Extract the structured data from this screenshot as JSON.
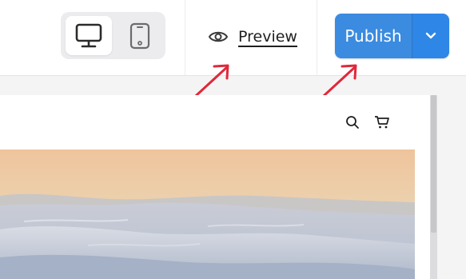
{
  "toolbar": {
    "device_toggle": {
      "desktop_icon": "monitor-icon",
      "mobile_icon": "smartphone-icon",
      "selected": "desktop"
    },
    "preview": {
      "icon": "eye-icon",
      "label": "Preview"
    },
    "publish": {
      "label": "Publish",
      "dropdown_icon": "chevron-down-icon"
    }
  },
  "canvas": {
    "header_icons": [
      "search-icon",
      "cart-icon"
    ]
  },
  "colors": {
    "publish_blue": "#3b8be0",
    "annotation_red": "#e0283a",
    "toggle_background": "#ececee"
  }
}
